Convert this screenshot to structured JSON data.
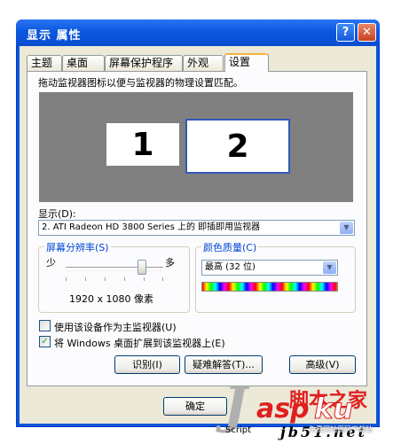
{
  "window": {
    "title": "显示 属性"
  },
  "titlebar_buttons": {
    "help": "?",
    "close": "✕"
  },
  "tabs": [
    {
      "label": "主题"
    },
    {
      "label": "桌面"
    },
    {
      "label": "屏幕保护程序"
    },
    {
      "label": "外观"
    },
    {
      "label": "设置"
    }
  ],
  "settings": {
    "instruction": "拖动监视器图标以便与监视器的物理设置匹配。",
    "monitors": [
      {
        "label": "1"
      },
      {
        "label": "2",
        "selected": true
      }
    ],
    "display_label": "显示(D):",
    "display_value": "2. ATI Radeon HD 3800 Series  上的 即插即用监视器",
    "resolution": {
      "legend": "屏幕分辨率(S)",
      "less": "少",
      "more": "多",
      "value_text": "1920 x 1080 像素",
      "slider_position": 0.78
    },
    "color_quality": {
      "legend": "颜色质量(C)",
      "value": "最高 (32 位)"
    },
    "check_primary": {
      "label": "使用该设备作为主监视器(U)",
      "checked": false
    },
    "check_extend": {
      "label": "将 Windows 桌面扩展到该监视器上(E)",
      "checked": true
    },
    "buttons": {
      "identify": "识别(I)",
      "troubleshoot": "疑难解答(T)...",
      "advanced": "高级(V)"
    }
  },
  "footer": {
    "ok": "确定"
  },
  "watermark": {
    "j": "J",
    "asp": "asp",
    "ku": "ku",
    "cn": "脚本之家",
    "script": "Script",
    "net": "jb51.net",
    "sub": "免费网站源码下载站"
  },
  "colors": {
    "title_bar": "#0a56d6",
    "client": "#ece9d8",
    "monitor_area": "#808080",
    "selected_border": "#2e5bb8"
  }
}
